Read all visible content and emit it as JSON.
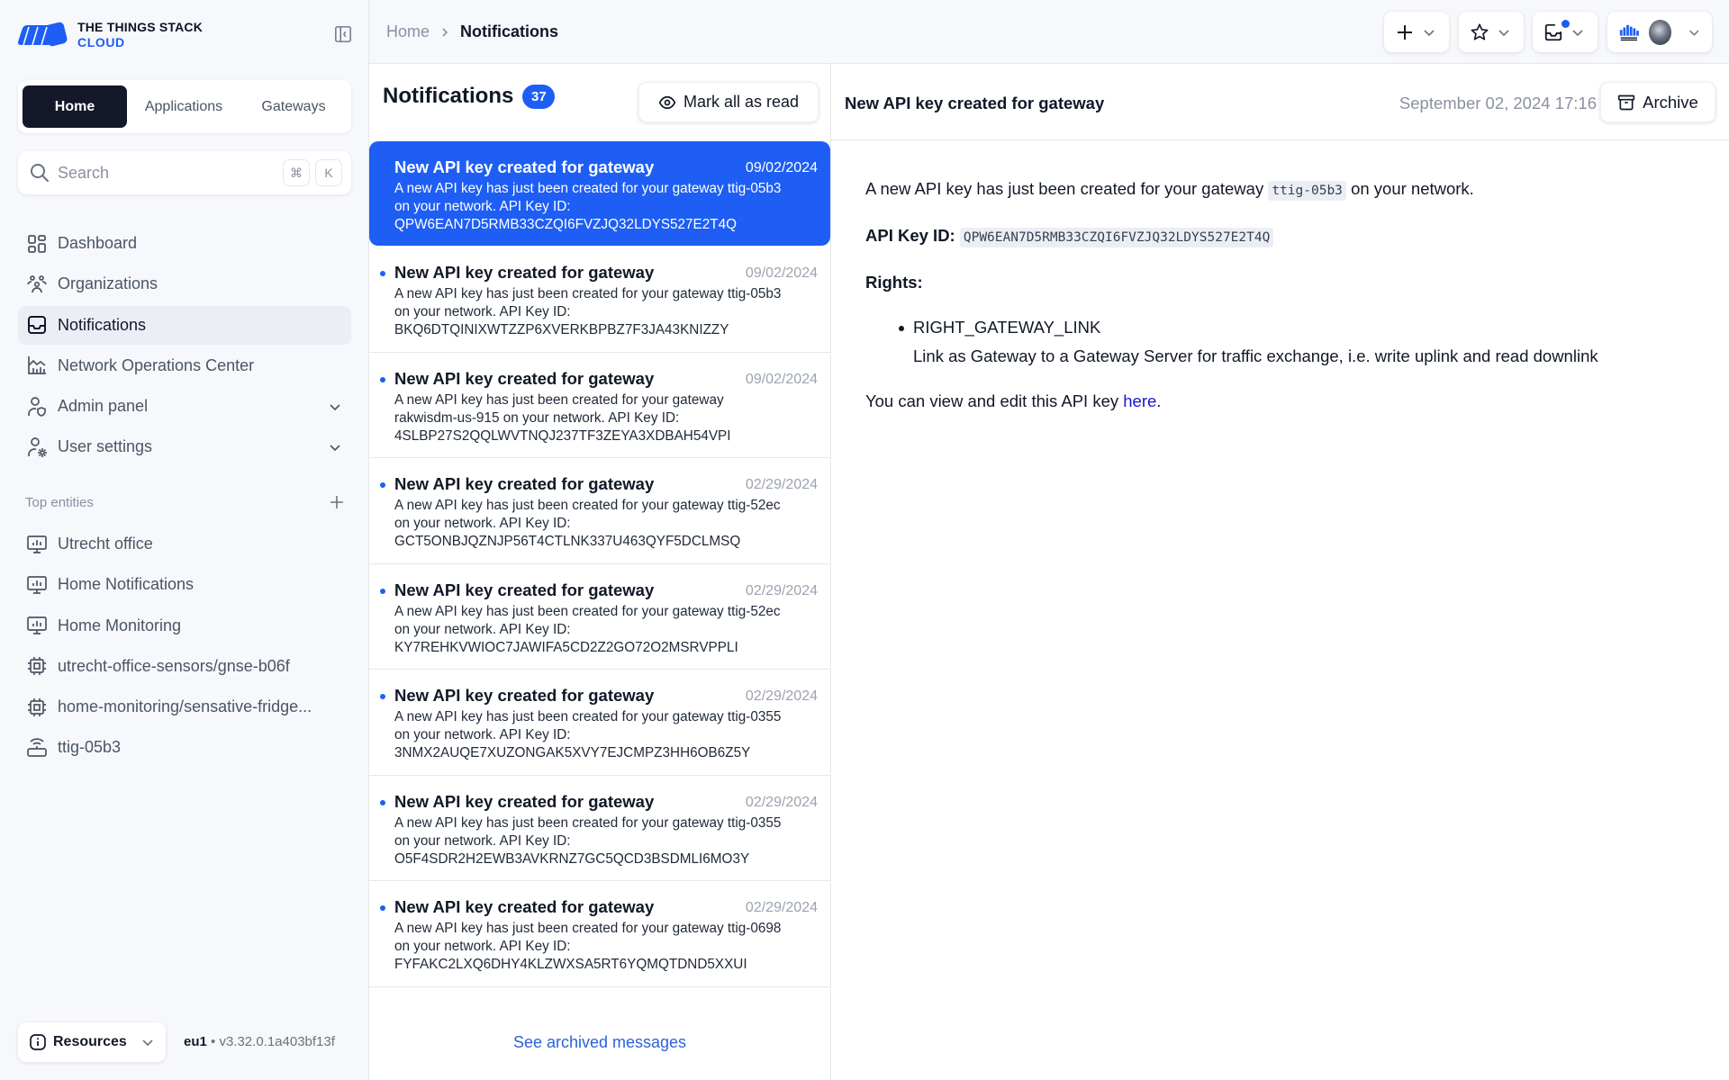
{
  "brand": {
    "line1": "THE THINGS STACK",
    "line2": "CLOUD",
    "accent": "#1e5ef5"
  },
  "switcher": {
    "tabs": [
      "Home",
      "Applications",
      "Gateways"
    ],
    "active": "Home"
  },
  "search": {
    "placeholder": "Search",
    "shortcut_keys": [
      "⌘",
      "K"
    ]
  },
  "sidebar": {
    "items": [
      {
        "label": "Dashboard",
        "icon": "dashboard-icon"
      },
      {
        "label": "Organizations",
        "icon": "organizations-icon"
      },
      {
        "label": "Notifications",
        "icon": "inbox-icon",
        "active": true
      },
      {
        "label": "Network Operations Center",
        "icon": "chart-icon"
      },
      {
        "label": "Admin panel",
        "icon": "user-shield-icon",
        "expandable": true
      },
      {
        "label": "User settings",
        "icon": "user-gear-icon",
        "expandable": true
      }
    ],
    "top_entities_label": "Top entities",
    "entities": [
      {
        "label": "Utrecht office",
        "icon": "application-icon"
      },
      {
        "label": "Home Notifications",
        "icon": "application-icon"
      },
      {
        "label": "Home Monitoring",
        "icon": "application-icon"
      },
      {
        "label": "utrecht-office-sensors/gnse-b06f",
        "icon": "device-icon"
      },
      {
        "label": "home-monitoring/sensative-fridge...",
        "icon": "device-icon"
      },
      {
        "label": "ttig-05b3",
        "icon": "gateway-icon"
      }
    ],
    "resources_label": "Resources",
    "cluster": "eu1",
    "version": "v3.32.0.1a403bf13f"
  },
  "breadcrumb": {
    "home": "Home",
    "current": "Notifications"
  },
  "notifications": {
    "title": "Notifications",
    "count": "37",
    "mark_all_label": "Mark all as read",
    "see_archived_label": "See archived messages",
    "items": [
      {
        "title": "New API key created for gateway",
        "date": "09/02/2024",
        "body": "A new API key has just been created for your gateway ttig-05b3 on your network. API Key ID: QPW6EAN7D5RMB33CZQI6FVZJQ32LDYS527E2T4Q",
        "selected": true,
        "unread": false
      },
      {
        "title": "New API key created for gateway",
        "date": "09/02/2024",
        "body": "A new API key has just been created for your gateway ttig-05b3 on your network. API Key ID: BKQ6DTQINIXWTZZP6XVERKBPBZ7F3JA43KNIZZY",
        "unread": true
      },
      {
        "title": "New API key created for gateway",
        "date": "09/02/2024",
        "body": "A new API key has just been created for your gateway rakwisdm-us-915 on your network. API Key ID: 4SLBP27S2QQLWVTNQJ237TF3ZEYA3XDBAH54VPI",
        "unread": true
      },
      {
        "title": "New API key created for gateway",
        "date": "02/29/2024",
        "body": "A new API key has just been created for your gateway ttig-52ec on your network. API Key ID: GCT5ONBJQZNJP56T4CTLNK337U463QYF5DCLMSQ",
        "unread": true
      },
      {
        "title": "New API key created for gateway",
        "date": "02/29/2024",
        "body": "A new API key has just been created for your gateway ttig-52ec on your network. API Key ID: KY7REHKVWIOC7JAWIFA5CD2Z2GO72O2MSRVPPLI",
        "unread": true
      },
      {
        "title": "New API key created for gateway",
        "date": "02/29/2024",
        "body": "A new API key has just been created for your gateway ttig-0355 on your network. API Key ID: 3NMX2AUQE7XUZONGAK5XVY7EJCMPZ3HH6OB6Z5Y",
        "unread": true
      },
      {
        "title": "New API key created for gateway",
        "date": "02/29/2024",
        "body": "A new API key has just been created for your gateway ttig-0355 on your network. API Key ID: O5F4SDR2H2EWB3AVKRNZ7GC5QCD3BSDMLI6MO3Y",
        "unread": true
      },
      {
        "title": "New API key created for gateway",
        "date": "02/29/2024",
        "body": "A new API key has just been created for your gateway ttig-0698 on your network. API Key ID: FYFAKC2LXQ6DHY4KLZWXSA5RT6YQMQTDND5XXUI",
        "unread": true
      }
    ]
  },
  "detail": {
    "title": "New API key created for gateway",
    "date": "September 02, 2024 17:16",
    "archive_label": "Archive",
    "intro_before": "A new API key has just been created for your gateway",
    "gateway_id": "ttig-05b3",
    "intro_after": "on your network.",
    "api_key_label": "API Key ID:",
    "api_key_id": "QPW6EAN7D5RMB33CZQI6FVZJQ32LDYS527E2T4Q",
    "rights_label": "Rights:",
    "rights": [
      {
        "name": "RIGHT_GATEWAY_LINK",
        "description": "Link as Gateway to a Gateway Server for traffic exchange, i.e. write uplink and read downlink"
      }
    ],
    "footer_before": "You can view and edit this API key",
    "footer_link": "here",
    "footer_after": "."
  }
}
